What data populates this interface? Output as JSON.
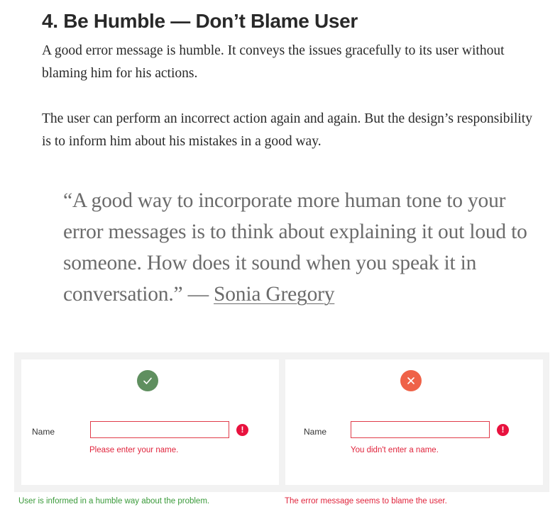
{
  "article": {
    "heading": "4. Be Humble — Don’t Blame User",
    "paragraphs": [
      "A good error message is humble. It conveys the issues gracefully to its user without blaming him for his actions.",
      "The user can perform an incorrect action again and again. But the design’s responsibility is to inform him about his mistakes in a good way."
    ],
    "quote": {
      "text": "“A good way to incorporate more human tone to your error messages is to think about explaining it out loud to someone. How does it sound when you speak it in conversation.” — ",
      "author": "Sonia Gregory"
    }
  },
  "figure": {
    "good_example": {
      "status_icon": "check-icon",
      "status_color": "#5f8f5f",
      "field_label": "Name",
      "field_value": "",
      "alert_icon_glyph": "!",
      "error_text": "Please enter your name.",
      "caption": "User is informed in a humble way about the problem.",
      "caption_color": "#3a9a3a"
    },
    "bad_example": {
      "status_icon": "x-icon",
      "status_color": "#ef6248",
      "field_label": "Name",
      "field_value": "",
      "alert_icon_glyph": "!",
      "error_text": "You didn't enter a name.",
      "caption": "The error message seems to blame the user.",
      "caption_color": "#e0243c"
    }
  },
  "colors": {
    "error_red": "#e8123e",
    "input_border": "#e03c4a",
    "figure_background": "#f2f2f2"
  }
}
